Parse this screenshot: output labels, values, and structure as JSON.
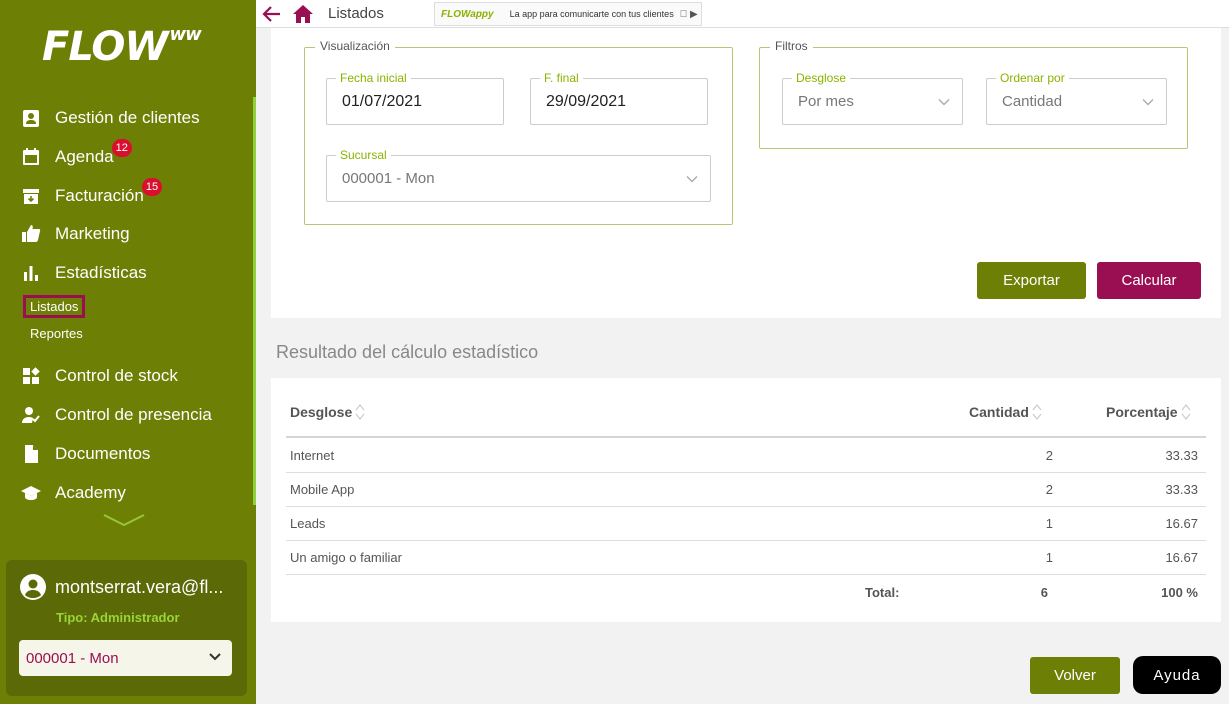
{
  "sidebar": {
    "logo_text": "FLOW",
    "logo_sup": "ww",
    "items": [
      {
        "label": "Gestión de clientes",
        "icon": "clients-icon"
      },
      {
        "label": "Agenda",
        "icon": "calendar-icon",
        "badge": "12"
      },
      {
        "label": "Facturación",
        "icon": "billing-icon",
        "badge": "15"
      },
      {
        "label": "Marketing",
        "icon": "thumbs-up-icon"
      },
      {
        "label": "Estadísticas",
        "icon": "bar-chart-icon"
      },
      {
        "label": "Control de stock",
        "icon": "stock-icon"
      },
      {
        "label": "Control de presencia",
        "icon": "presence-icon"
      },
      {
        "label": "Documentos",
        "icon": "document-icon"
      },
      {
        "label": "Academy",
        "icon": "graduation-icon"
      }
    ],
    "sub_items": [
      {
        "label": "Listados",
        "active": true
      },
      {
        "label": "Reportes",
        "active": false
      }
    ],
    "user": {
      "email": "montserrat.vera@fl...",
      "type_label": "Tipo: Administrador",
      "branch": "000001 - Mon"
    }
  },
  "topbar": {
    "title": "Listados",
    "banner_logo": "FLOWappy",
    "banner_text": "La app para comunicarte con tus clientes"
  },
  "visualizacion": {
    "legend": "Visualización",
    "fecha_inicial_label": "Fecha inicial",
    "fecha_inicial_value": "01/07/2021",
    "fecha_final_label": "F. final",
    "fecha_final_value": "29/09/2021",
    "sucursal_label": "Sucursal",
    "sucursal_value": "000001 - Mon"
  },
  "filtros": {
    "legend": "Filtros",
    "desglose_label": "Desglose",
    "desglose_value": "Por mes",
    "ordenar_label": "Ordenar por",
    "ordenar_value": "Cantidad"
  },
  "actions": {
    "export_label": "Exportar",
    "calc_label": "Calcular",
    "back_label": "Volver",
    "help_label": "Ayuda"
  },
  "result": {
    "title": "Resultado del cálculo estadístico",
    "columns": [
      "Desglose",
      "Cantidad",
      "Porcentaje"
    ],
    "rows": [
      {
        "desglose": "Internet",
        "cantidad": "2",
        "porcentaje": "33.33"
      },
      {
        "desglose": "Mobile App",
        "cantidad": "2",
        "porcentaje": "33.33"
      },
      {
        "desglose": "Leads",
        "cantidad": "1",
        "porcentaje": "16.67"
      },
      {
        "desglose": "Un amigo o familiar",
        "cantidad": "1",
        "porcentaje": "16.67"
      }
    ],
    "total_label": "Total:",
    "total_cantidad": "6",
    "total_porcentaje": "100 %"
  },
  "colors": {
    "sidebar": "#6e7f06",
    "accent_green": "#8ab300",
    "accent_magenta": "#9a0e52",
    "badge_red": "#d8102d"
  }
}
